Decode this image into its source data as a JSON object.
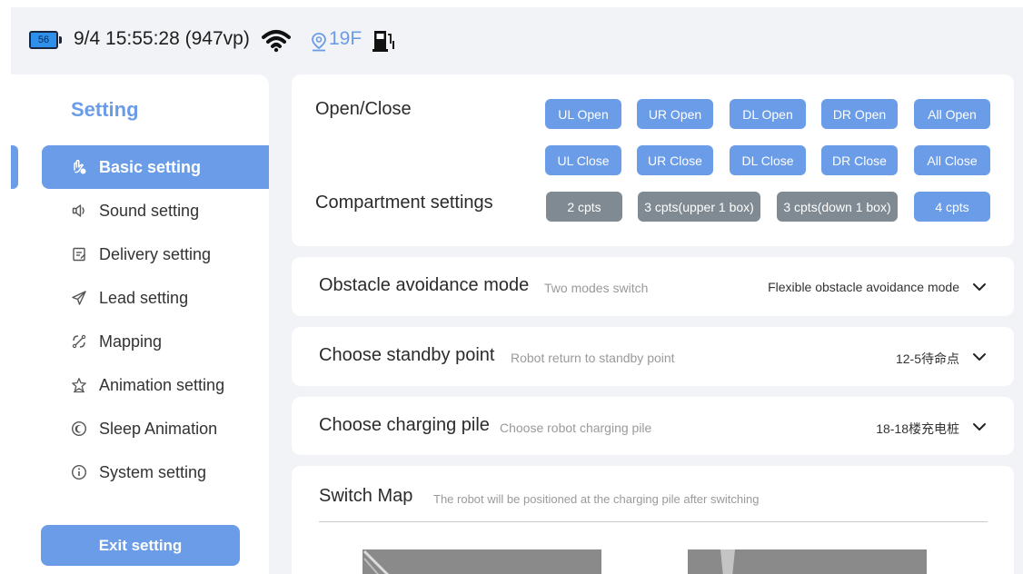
{
  "status": {
    "battery_level": "56",
    "datetime": "9/4 15:55:28 (947vp)",
    "floor": "19F"
  },
  "sidebar": {
    "title": "Setting",
    "items": [
      {
        "label": "Basic setting",
        "icon": "hand-icon",
        "active": true
      },
      {
        "label": "Sound setting",
        "icon": "speaker-icon"
      },
      {
        "label": "Delivery setting",
        "icon": "clipboard-icon"
      },
      {
        "label": "Lead setting",
        "icon": "paper-plane-icon"
      },
      {
        "label": "Mapping",
        "icon": "mapping-icon"
      },
      {
        "label": "Animation setting",
        "icon": "star-icon"
      },
      {
        "label": "Sleep Animation",
        "icon": "moon-icon"
      },
      {
        "label": "System setting",
        "icon": "info-icon"
      }
    ],
    "exit_label": "Exit setting"
  },
  "open_close": {
    "label": "Open/Close",
    "open_buttons": [
      "UL Open",
      "UR Open",
      "DL Open",
      "DR Open",
      "All Open"
    ],
    "close_buttons": [
      "UL Close",
      "UR Close",
      "DL Close",
      "DR Close",
      "All Close"
    ]
  },
  "compartment": {
    "label": "Compartment settings",
    "options": [
      {
        "label": "2 cpts",
        "selected": false
      },
      {
        "label": "3 cpts(upper 1 box)",
        "selected": false
      },
      {
        "label": "3 cpts(down 1 box)",
        "selected": false
      },
      {
        "label": "4 cpts",
        "selected": true
      }
    ]
  },
  "obstacle": {
    "title": "Obstacle avoidance mode",
    "hint": "Two modes switch",
    "value": "Flexible obstacle avoidance mode"
  },
  "standby": {
    "title": "Choose standby point",
    "hint": "Robot return to standby point",
    "value": "12-5待命点"
  },
  "charging": {
    "title": "Choose charging pile",
    "hint": "Choose robot charging pile",
    "value": "18-18楼充电桩"
  },
  "switch_map": {
    "title": "Switch Map",
    "hint": "The robot will be positioned at the charging pile after switching"
  },
  "colors": {
    "accent": "#6b9ce8",
    "inactive_button": "#7f8a93",
    "background": "#f1f3f6"
  }
}
